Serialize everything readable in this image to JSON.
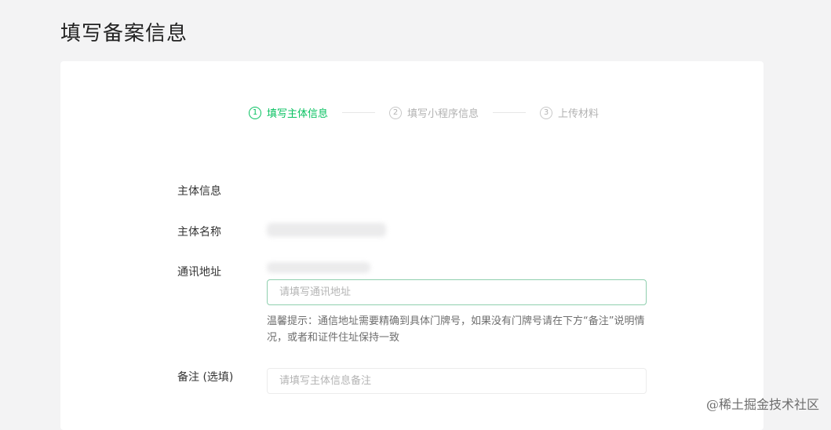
{
  "page": {
    "title": "填写备案信息"
  },
  "steps": [
    {
      "number": "1",
      "label": "填写主体信息",
      "active": true
    },
    {
      "number": "2",
      "label": "填写小程序信息",
      "active": false
    },
    {
      "number": "3",
      "label": "上传材料",
      "active": false
    }
  ],
  "form": {
    "section_title": "主体信息",
    "subject_name_label": "主体名称",
    "address_label": "通讯地址",
    "address_placeholder": "请填写通讯地址",
    "address_hint": "温馨提示：通信地址需要精确到具体门牌号，如果没有门牌号请在下方“备注”说明情况，或者和证件住址保持一致",
    "remark_label": "备注 (选填)",
    "remark_placeholder": "请填写主体信息备注"
  },
  "watermark": "@稀土掘金技术社区",
  "colors": {
    "accent": "#07c160",
    "background": "#f3f3f4",
    "card": "#ffffff"
  }
}
